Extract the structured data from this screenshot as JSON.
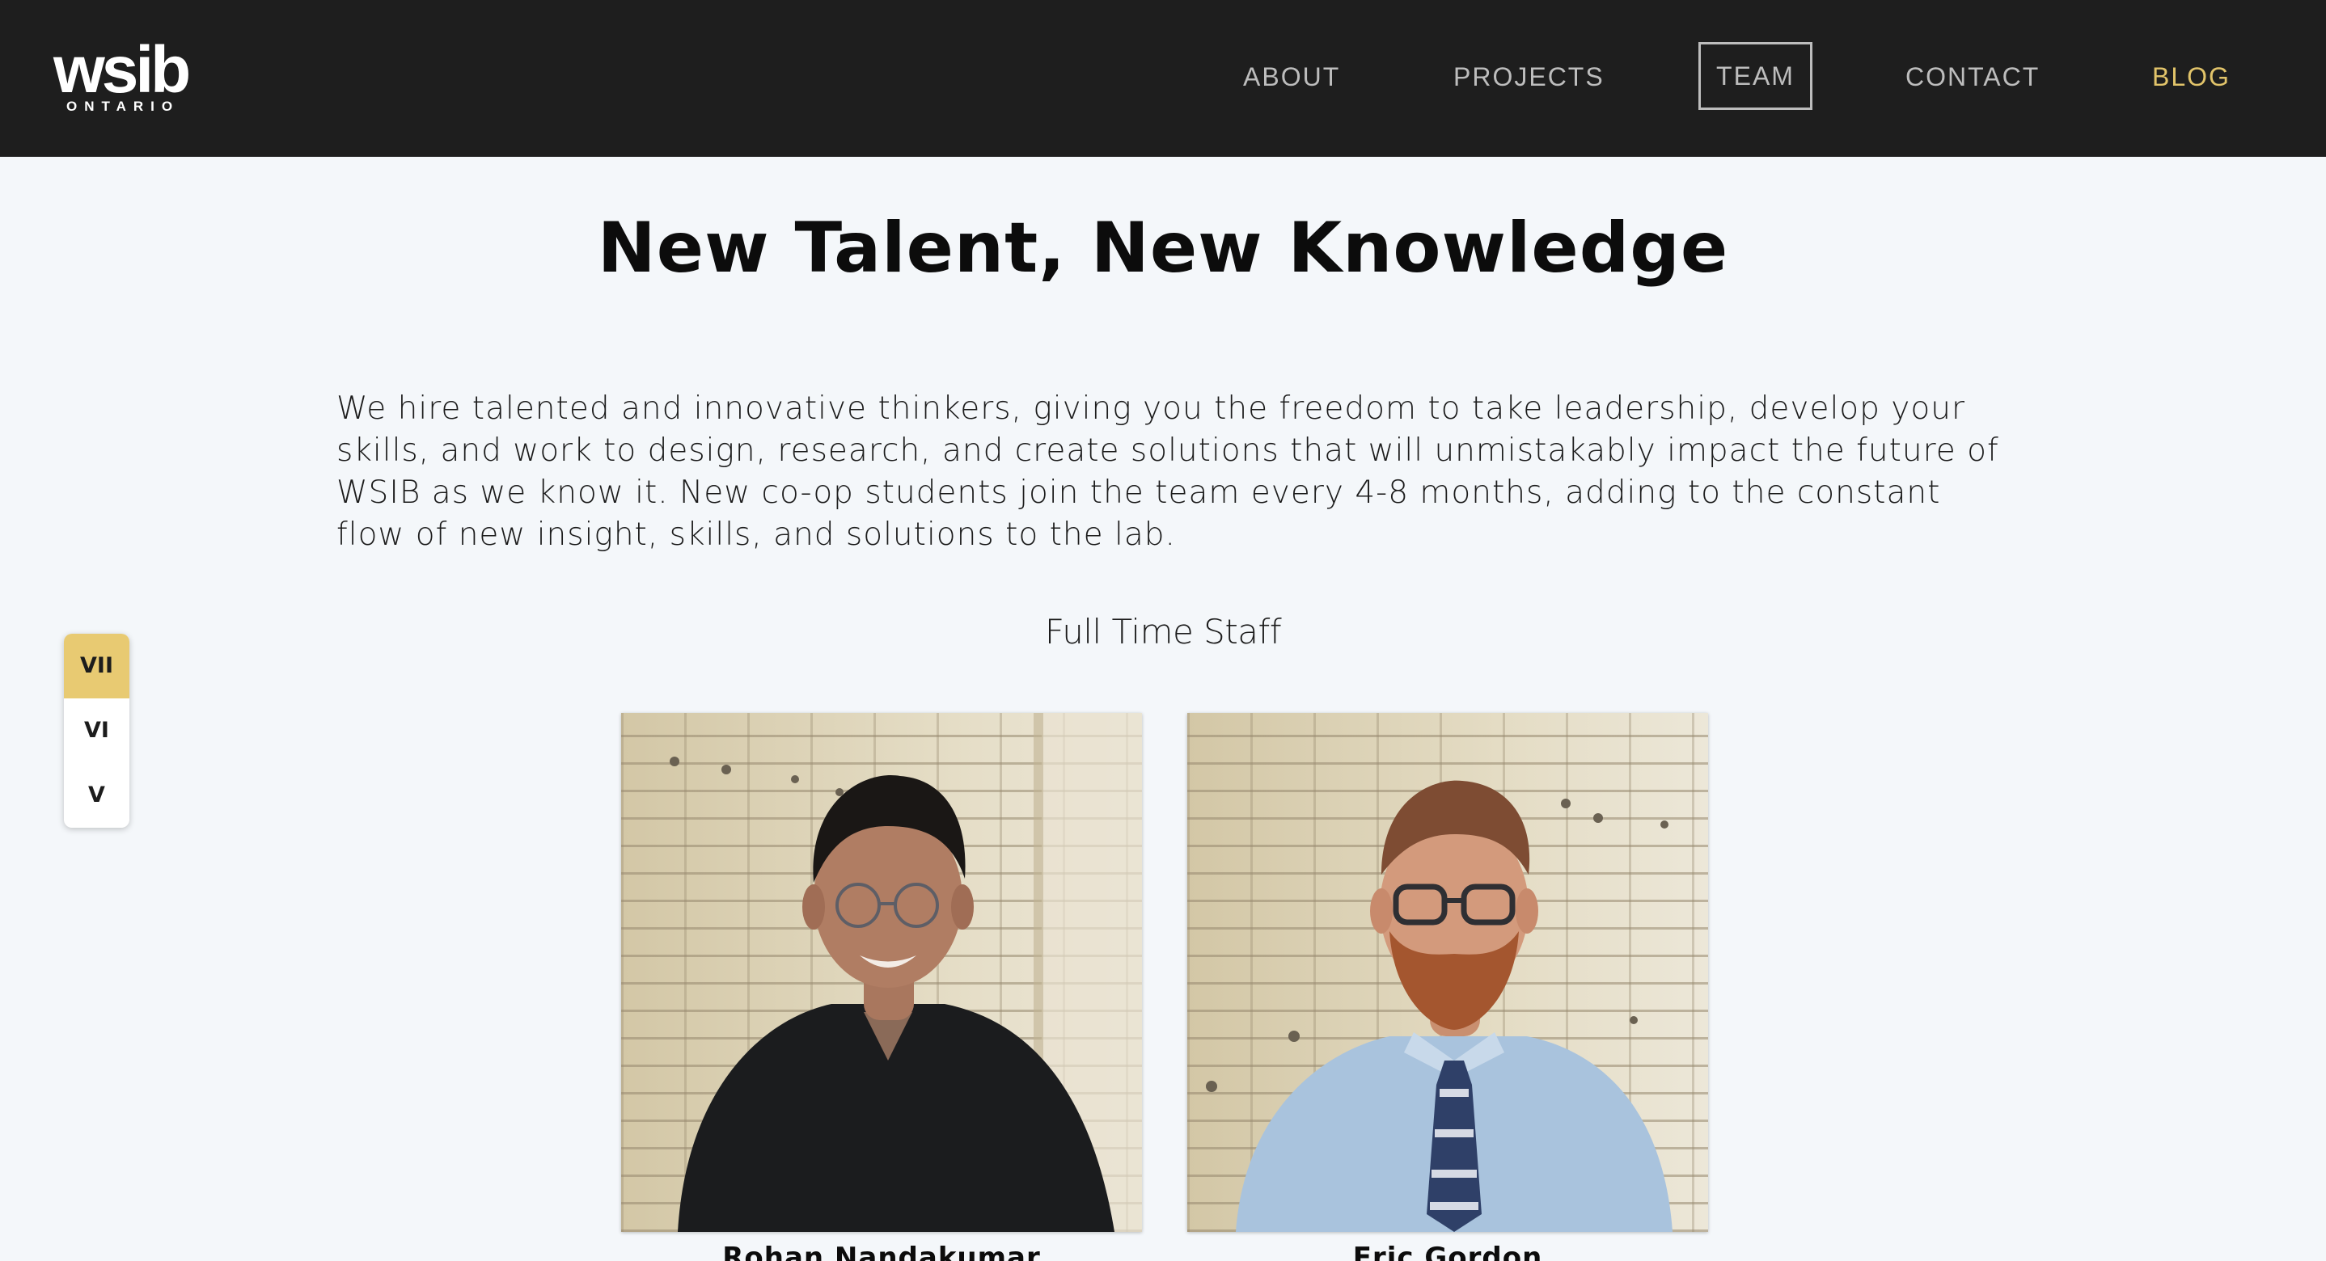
{
  "brand": {
    "logo_main": "wsib",
    "logo_sub": "ONTARIO"
  },
  "nav": {
    "about": "ABOUT",
    "projects": "PROJECTS",
    "team": "TEAM",
    "contact": "CONTACT",
    "blog": "BLOG",
    "active": "TEAM",
    "blog_color": "#e2c46a"
  },
  "main": {
    "title": "New Talent, New Knowledge",
    "intro": "We hire talented and innovative thinkers, giving you the freedom to take leadership, develop your skills, and work to design, research, and create solutions that will unmistakably impact the future of WSIB as we know it. New co-op students join the team every 4-8 months, adding to the constant flow of new insight, skills, and solutions to the lab.",
    "section_title": "Full Time Staff"
  },
  "year_switch": {
    "items": [
      "VII",
      "VI",
      "V"
    ],
    "active": "VII",
    "active_color": "#e8ca72"
  },
  "staff": [
    {
      "name": "Rohan Nandakumar"
    },
    {
      "name": "Eric Gordon"
    }
  ]
}
